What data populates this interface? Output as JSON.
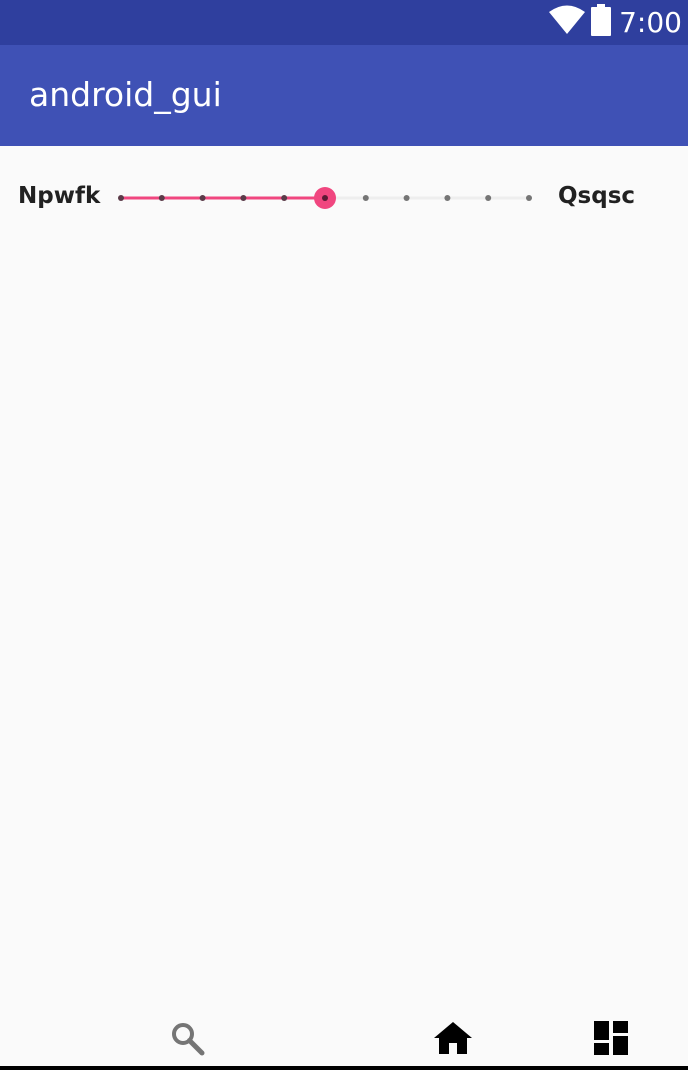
{
  "status_bar": {
    "time": "7:00",
    "icons": [
      "wifi-icon",
      "battery-icon"
    ],
    "background": "#2f3f9e"
  },
  "app_bar": {
    "title": "android_gui",
    "background": "#3f51b5"
  },
  "slider": {
    "min_label": "Npwfk",
    "max_label": "Qsqsc",
    "steps": 10,
    "value": 5,
    "accent": "#f0467f"
  },
  "bottom_nav": {
    "items": [
      {
        "icon": "search-icon"
      },
      {
        "icon": "home-icon"
      },
      {
        "icon": "dashboard-icon"
      }
    ]
  }
}
